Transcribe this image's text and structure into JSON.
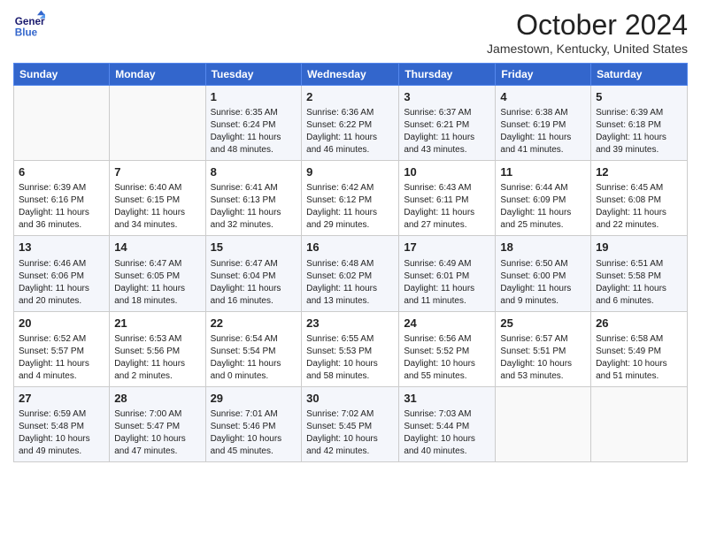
{
  "header": {
    "logo_line1": "General",
    "logo_line2": "Blue",
    "month_title": "October 2024",
    "location": "Jamestown, Kentucky, United States"
  },
  "weekdays": [
    "Sunday",
    "Monday",
    "Tuesday",
    "Wednesday",
    "Thursday",
    "Friday",
    "Saturday"
  ],
  "weeks": [
    [
      {
        "day": "",
        "sunrise": "",
        "sunset": "",
        "daylight": ""
      },
      {
        "day": "",
        "sunrise": "",
        "sunset": "",
        "daylight": ""
      },
      {
        "day": "1",
        "sunrise": "Sunrise: 6:35 AM",
        "sunset": "Sunset: 6:24 PM",
        "daylight": "Daylight: 11 hours and 48 minutes."
      },
      {
        "day": "2",
        "sunrise": "Sunrise: 6:36 AM",
        "sunset": "Sunset: 6:22 PM",
        "daylight": "Daylight: 11 hours and 46 minutes."
      },
      {
        "day": "3",
        "sunrise": "Sunrise: 6:37 AM",
        "sunset": "Sunset: 6:21 PM",
        "daylight": "Daylight: 11 hours and 43 minutes."
      },
      {
        "day": "4",
        "sunrise": "Sunrise: 6:38 AM",
        "sunset": "Sunset: 6:19 PM",
        "daylight": "Daylight: 11 hours and 41 minutes."
      },
      {
        "day": "5",
        "sunrise": "Sunrise: 6:39 AM",
        "sunset": "Sunset: 6:18 PM",
        "daylight": "Daylight: 11 hours and 39 minutes."
      }
    ],
    [
      {
        "day": "6",
        "sunrise": "Sunrise: 6:39 AM",
        "sunset": "Sunset: 6:16 PM",
        "daylight": "Daylight: 11 hours and 36 minutes."
      },
      {
        "day": "7",
        "sunrise": "Sunrise: 6:40 AM",
        "sunset": "Sunset: 6:15 PM",
        "daylight": "Daylight: 11 hours and 34 minutes."
      },
      {
        "day": "8",
        "sunrise": "Sunrise: 6:41 AM",
        "sunset": "Sunset: 6:13 PM",
        "daylight": "Daylight: 11 hours and 32 minutes."
      },
      {
        "day": "9",
        "sunrise": "Sunrise: 6:42 AM",
        "sunset": "Sunset: 6:12 PM",
        "daylight": "Daylight: 11 hours and 29 minutes."
      },
      {
        "day": "10",
        "sunrise": "Sunrise: 6:43 AM",
        "sunset": "Sunset: 6:11 PM",
        "daylight": "Daylight: 11 hours and 27 minutes."
      },
      {
        "day": "11",
        "sunrise": "Sunrise: 6:44 AM",
        "sunset": "Sunset: 6:09 PM",
        "daylight": "Daylight: 11 hours and 25 minutes."
      },
      {
        "day": "12",
        "sunrise": "Sunrise: 6:45 AM",
        "sunset": "Sunset: 6:08 PM",
        "daylight": "Daylight: 11 hours and 22 minutes."
      }
    ],
    [
      {
        "day": "13",
        "sunrise": "Sunrise: 6:46 AM",
        "sunset": "Sunset: 6:06 PM",
        "daylight": "Daylight: 11 hours and 20 minutes."
      },
      {
        "day": "14",
        "sunrise": "Sunrise: 6:47 AM",
        "sunset": "Sunset: 6:05 PM",
        "daylight": "Daylight: 11 hours and 18 minutes."
      },
      {
        "day": "15",
        "sunrise": "Sunrise: 6:47 AM",
        "sunset": "Sunset: 6:04 PM",
        "daylight": "Daylight: 11 hours and 16 minutes."
      },
      {
        "day": "16",
        "sunrise": "Sunrise: 6:48 AM",
        "sunset": "Sunset: 6:02 PM",
        "daylight": "Daylight: 11 hours and 13 minutes."
      },
      {
        "day": "17",
        "sunrise": "Sunrise: 6:49 AM",
        "sunset": "Sunset: 6:01 PM",
        "daylight": "Daylight: 11 hours and 11 minutes."
      },
      {
        "day": "18",
        "sunrise": "Sunrise: 6:50 AM",
        "sunset": "Sunset: 6:00 PM",
        "daylight": "Daylight: 11 hours and 9 minutes."
      },
      {
        "day": "19",
        "sunrise": "Sunrise: 6:51 AM",
        "sunset": "Sunset: 5:58 PM",
        "daylight": "Daylight: 11 hours and 6 minutes."
      }
    ],
    [
      {
        "day": "20",
        "sunrise": "Sunrise: 6:52 AM",
        "sunset": "Sunset: 5:57 PM",
        "daylight": "Daylight: 11 hours and 4 minutes."
      },
      {
        "day": "21",
        "sunrise": "Sunrise: 6:53 AM",
        "sunset": "Sunset: 5:56 PM",
        "daylight": "Daylight: 11 hours and 2 minutes."
      },
      {
        "day": "22",
        "sunrise": "Sunrise: 6:54 AM",
        "sunset": "Sunset: 5:54 PM",
        "daylight": "Daylight: 11 hours and 0 minutes."
      },
      {
        "day": "23",
        "sunrise": "Sunrise: 6:55 AM",
        "sunset": "Sunset: 5:53 PM",
        "daylight": "Daylight: 10 hours and 58 minutes."
      },
      {
        "day": "24",
        "sunrise": "Sunrise: 6:56 AM",
        "sunset": "Sunset: 5:52 PM",
        "daylight": "Daylight: 10 hours and 55 minutes."
      },
      {
        "day": "25",
        "sunrise": "Sunrise: 6:57 AM",
        "sunset": "Sunset: 5:51 PM",
        "daylight": "Daylight: 10 hours and 53 minutes."
      },
      {
        "day": "26",
        "sunrise": "Sunrise: 6:58 AM",
        "sunset": "Sunset: 5:49 PM",
        "daylight": "Daylight: 10 hours and 51 minutes."
      }
    ],
    [
      {
        "day": "27",
        "sunrise": "Sunrise: 6:59 AM",
        "sunset": "Sunset: 5:48 PM",
        "daylight": "Daylight: 10 hours and 49 minutes."
      },
      {
        "day": "28",
        "sunrise": "Sunrise: 7:00 AM",
        "sunset": "Sunset: 5:47 PM",
        "daylight": "Daylight: 10 hours and 47 minutes."
      },
      {
        "day": "29",
        "sunrise": "Sunrise: 7:01 AM",
        "sunset": "Sunset: 5:46 PM",
        "daylight": "Daylight: 10 hours and 45 minutes."
      },
      {
        "day": "30",
        "sunrise": "Sunrise: 7:02 AM",
        "sunset": "Sunset: 5:45 PM",
        "daylight": "Daylight: 10 hours and 42 minutes."
      },
      {
        "day": "31",
        "sunrise": "Sunrise: 7:03 AM",
        "sunset": "Sunset: 5:44 PM",
        "daylight": "Daylight: 10 hours and 40 minutes."
      },
      {
        "day": "",
        "sunrise": "",
        "sunset": "",
        "daylight": ""
      },
      {
        "day": "",
        "sunrise": "",
        "sunset": "",
        "daylight": ""
      }
    ]
  ]
}
